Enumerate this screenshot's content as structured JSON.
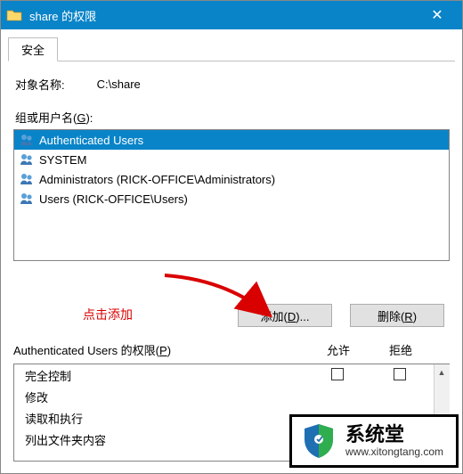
{
  "window": {
    "title": "share 的权限",
    "close_symbol": "✕"
  },
  "tab": {
    "security": "安全"
  },
  "object": {
    "label": "对象名称:",
    "path": "C:\\share"
  },
  "groups": {
    "label_prefix": "组或用户名(",
    "label_key": "G",
    "label_suffix": "):",
    "items": [
      {
        "name": "Authenticated Users",
        "selected": true
      },
      {
        "name": "SYSTEM",
        "selected": false
      },
      {
        "name": "Administrators (RICK-OFFICE\\Administrators)",
        "selected": false
      },
      {
        "name": "Users (RICK-OFFICE\\Users)",
        "selected": false
      }
    ]
  },
  "annotation": {
    "text": "点击添加"
  },
  "buttons": {
    "add_prefix": "添加(",
    "add_key": "D",
    "add_suffix": ")...",
    "remove_prefix": "删除(",
    "remove_key": "R",
    "remove_suffix": ")"
  },
  "perm": {
    "label_prefix": "Authenticated Users 的权限(",
    "label_key": "P",
    "label_suffix": ")",
    "allow": "允许",
    "deny": "拒绝",
    "rows": [
      {
        "name": "完全控制",
        "show_checks": true
      },
      {
        "name": "修改",
        "show_checks": false
      },
      {
        "name": "读取和执行",
        "show_checks": false
      },
      {
        "name": "列出文件夹内容",
        "show_checks": false
      }
    ]
  },
  "watermark": {
    "title": "系统堂",
    "url": "www.xitongtang.com"
  }
}
